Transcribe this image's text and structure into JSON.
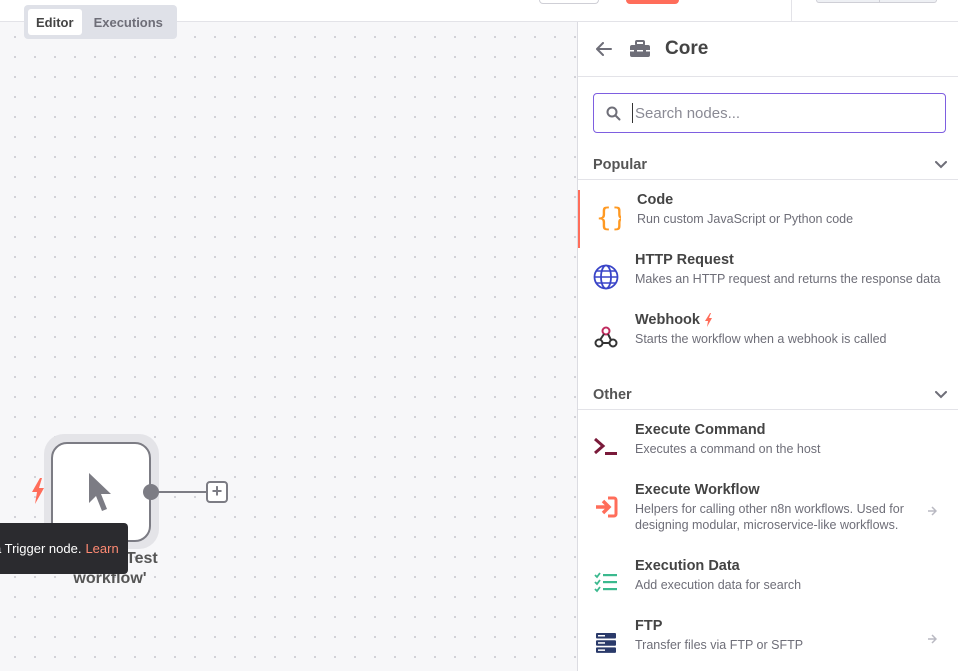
{
  "tabs": [
    {
      "label": "Editor",
      "active": true
    },
    {
      "label": "Executions",
      "active": false
    }
  ],
  "canvas": {
    "node_label_line1": "g 'Test",
    "node_label_line2": "workflow'",
    "tooltip_text": "a Trigger node.",
    "tooltip_link": "Learn",
    "plus_icon": "+"
  },
  "panel": {
    "title": "Core",
    "search_placeholder": "Search nodes...",
    "sections": [
      {
        "label": "Popular",
        "items": [
          {
            "name": "Code",
            "desc": "Run custom JavaScript or Python code",
            "icon": "code-icon",
            "selected": true
          },
          {
            "name": "HTTP Request",
            "desc": "Makes an HTTP request and returns the response data",
            "icon": "globe-icon"
          },
          {
            "name": "Webhook",
            "desc": "Starts the workflow when a webhook is called",
            "icon": "webhook-icon",
            "trigger": true
          }
        ]
      },
      {
        "label": "Other",
        "items": [
          {
            "name": "Execute Command",
            "desc": "Executes a command on the host",
            "icon": "terminal-icon"
          },
          {
            "name": "Execute Workflow",
            "desc": "Helpers for calling other n8n workflows. Used for designing modular, microservice-like workflows.",
            "icon": "sign-in-icon",
            "has_children": true
          },
          {
            "name": "Execution Data",
            "desc": "Add execution data for search",
            "icon": "tasks-icon"
          },
          {
            "name": "FTP",
            "desc": "Transfer files via FTP or SFTP",
            "icon": "server-icon",
            "has_children": true
          }
        ]
      }
    ]
  },
  "colors": {
    "accent": "#ff6d5a",
    "focus": "#7e5ee0",
    "code_orange": "#ff9922",
    "globe_blue": "#3a45c8",
    "terminal": "#7a1a3a",
    "data_green": "#3bb98e",
    "ftp_navy": "#2a3a6a"
  }
}
